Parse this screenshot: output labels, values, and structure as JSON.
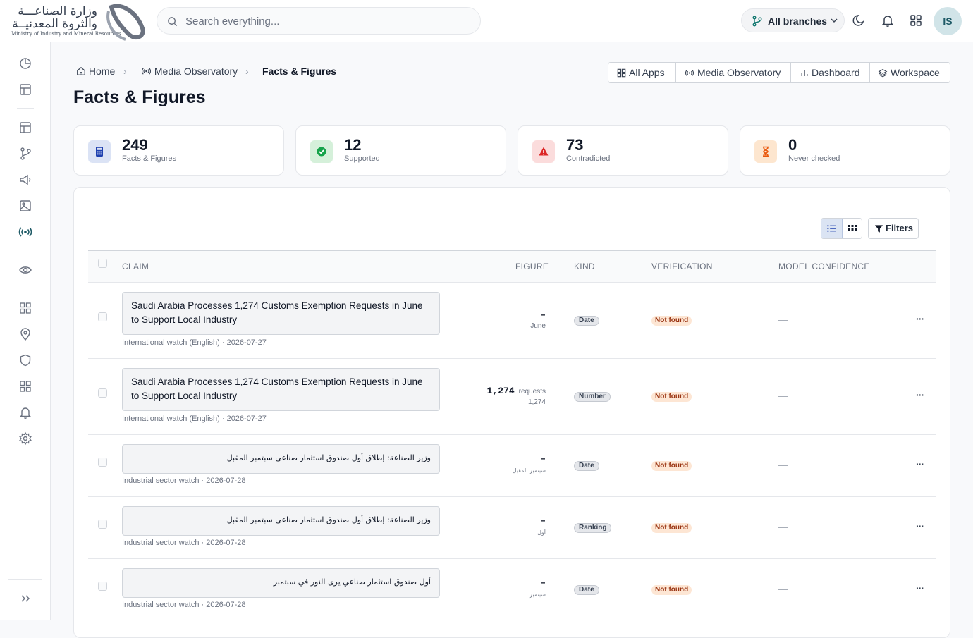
{
  "brand": {
    "name_ar_line1": "وزارة الصناعـــة",
    "name_ar_line2": "والثروة المعدنيــة",
    "name_en": "Ministry of Industry and Mineral Resources"
  },
  "header": {
    "search_placeholder": "Search everything...",
    "branch_selector": "All branches",
    "user_initials": "IS",
    "icons": [
      "search-icon",
      "git-branch-icon",
      "chevron-down-icon",
      "moon-icon",
      "bell-icon",
      "apps-grid-icon"
    ]
  },
  "sidebar": {
    "items": [
      "pie-chart-icon",
      "layout-icon",
      "layout-icon",
      "git-branch-icon",
      "megaphone-icon",
      "image-icon",
      "broadcast-icon",
      "eye-icon",
      "grid-icon",
      "map-pin-icon",
      "shield-icon",
      "grid-icon",
      "bell-icon",
      "gear-icon"
    ],
    "active": "broadcast-icon",
    "expand_icon": "chevrons-right-icon"
  },
  "breadcrumb": {
    "home": "Home",
    "section": "Media Observatory",
    "current": "Facts & Figures"
  },
  "app_nav": {
    "all_apps": "All Apps",
    "media_observatory": "Media Observatory",
    "dashboard": "Dashboard",
    "workspace": "Workspace"
  },
  "page_title": "Facts & Figures",
  "stats": [
    {
      "value": "249",
      "label": "Facts & Figures",
      "icon": "calculator-icon",
      "color": "#1e40af"
    },
    {
      "value": "12",
      "label": "Supported",
      "icon": "check-circle-icon",
      "color": "#16a34a"
    },
    {
      "value": "73",
      "label": "Contradicted",
      "icon": "warning-icon",
      "color": "#dc2626"
    },
    {
      "value": "0",
      "label": "Never checked",
      "icon": "hourglass-icon",
      "color": "#ea580c"
    }
  ],
  "toolbar": {
    "filters_label": "Filters"
  },
  "table": {
    "columns": {
      "claim": "CLAIM",
      "figure": "FIGURE",
      "kind": "KIND",
      "verification": "VERIFICATION",
      "confidence": "MODEL CONFIDENCE"
    },
    "rows": [
      {
        "claim": "Saudi Arabia Processes 1,274 Customs Exemption Requests in June to Support Local Industry",
        "meta": "International watch (English) · 2026-07-27",
        "figure": "–",
        "figure_unit": "",
        "figure_sub": "June",
        "kind": "Date",
        "verification": "Not found",
        "confidence": "—"
      },
      {
        "claim": "Saudi Arabia Processes 1,274 Customs Exemption Requests in June to Support Local Industry",
        "meta": "International watch (English) · 2026-07-27",
        "figure": "1,274",
        "figure_unit": "requests",
        "figure_sub": "1,274",
        "kind": "Number",
        "verification": "Not found",
        "confidence": "—"
      },
      {
        "claim": "وزير الصناعة: إطلاق أول صندوق استثمار صناعي سبتمبر المقبل",
        "meta": "Industrial sector watch · 2026-07-28",
        "figure": "–",
        "figure_unit": "",
        "figure_sub": "سبتمبر المقبل",
        "kind": "Date",
        "verification": "Not found",
        "confidence": "—"
      },
      {
        "claim": "وزير الصناعة: إطلاق أول صندوق استثمار صناعي سبتمبر المقبل",
        "meta": "Industrial sector watch · 2026-07-28",
        "figure": "–",
        "figure_unit": "",
        "figure_sub": "أول",
        "kind": "Ranking",
        "verification": "Not found",
        "confidence": "—"
      },
      {
        "claim": "أول صندوق استثمار صناعي يرى النور في سبتمبر",
        "meta": "Industrial sector watch · 2026-07-28",
        "figure": "–",
        "figure_unit": "",
        "figure_sub": "سبتمبر",
        "kind": "Date",
        "verification": "Not found",
        "confidence": "—"
      }
    ]
  }
}
